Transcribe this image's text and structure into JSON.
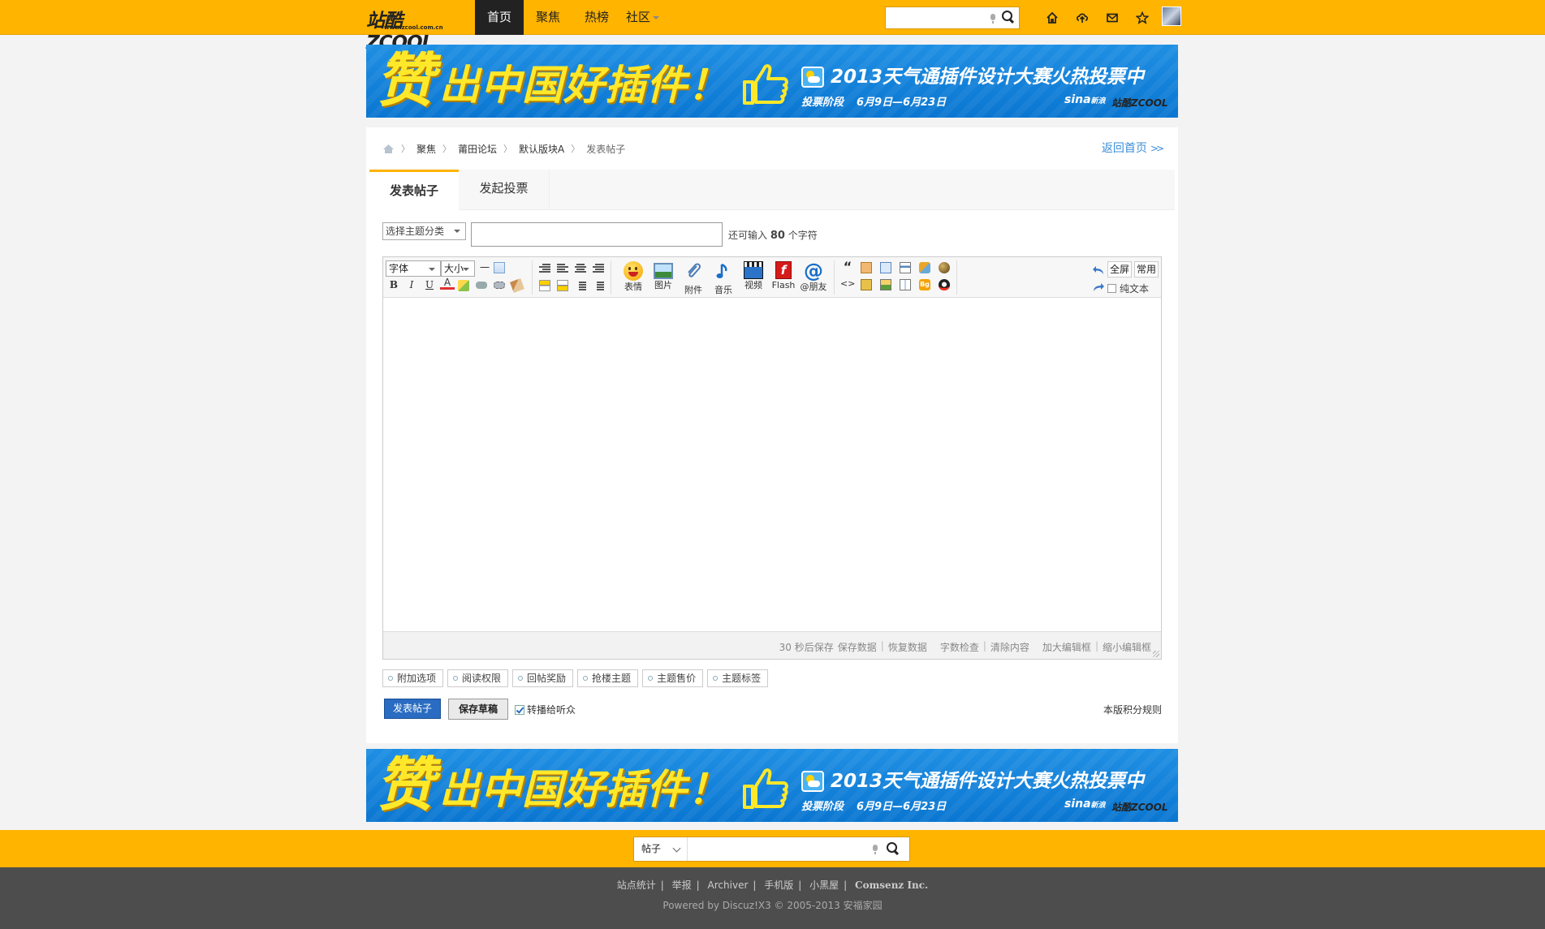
{
  "topbar": {
    "logo_text": "站酷ZCOOL",
    "logo_url_text": "www.zcool.com.cn",
    "nav": [
      {
        "label": "首页",
        "active": true
      },
      {
        "label": "聚焦",
        "active": false
      },
      {
        "label": "热榜",
        "active": false
      },
      {
        "label": "社区",
        "active": false
      }
    ],
    "search_placeholder": "",
    "icons": [
      "home-icon",
      "upload-icon",
      "mail-icon",
      "star-icon"
    ]
  },
  "banner": {
    "zan": "赞",
    "slogan": "出中国好插件！",
    "contest": "2013天气通插件设计大赛火热投票中",
    "phase": "投票阶段",
    "dates": "6月9日—6月23日",
    "sina": "sina",
    "sina_cn": "新浪",
    "zcool": "站酷ZCOOL"
  },
  "breadcrumb": {
    "items": [
      "聚焦",
      "莆田论坛",
      "默认版块A",
      "发表帖子"
    ],
    "back_home": "返回首页"
  },
  "tabs": [
    {
      "label": "发表帖子",
      "active": true
    },
    {
      "label": "发起投票",
      "active": false
    }
  ],
  "form": {
    "category_select": "选择主题分类",
    "title_value": "",
    "char_count_prefix": "还可输入",
    "char_count_value": "80",
    "char_count_suffix": "个字符"
  },
  "editor": {
    "font_select": "字体",
    "size_select": "大小",
    "fmt": {
      "bold": "B",
      "italic": "I",
      "underline": "U",
      "color": "A",
      "hr": "一"
    },
    "big_buttons": [
      {
        "label": "表情",
        "icon": "smiley-icon"
      },
      {
        "label": "图片",
        "icon": "image-icon"
      },
      {
        "label": "附件",
        "icon": "paperclip-icon"
      },
      {
        "label": "音乐",
        "icon": "music-icon"
      },
      {
        "label": "视频",
        "icon": "video-icon"
      },
      {
        "label": "Flash",
        "icon": "flash-icon"
      },
      {
        "label": "@朋友",
        "icon": "at-icon"
      }
    ],
    "quote": "“",
    "code": "<>",
    "fullscreen": "全屏",
    "common": "常用",
    "plain_text": "纯文本",
    "footer": {
      "autosave": "30 秒后保存",
      "save_data": "保存数据",
      "restore_data": "恢复数据",
      "word_check": "字数检查",
      "clear": "清除内容",
      "enlarge": "加大编辑框",
      "shrink": "缩小编辑框"
    },
    "colors": {
      "accent": "#ffb400",
      "button_blue": "#2a6cc2",
      "link_blue": "#3b8ed6"
    }
  },
  "options": [
    "附加选项",
    "阅读权限",
    "回帖奖励",
    "抢楼主题",
    "主题售价",
    "主题标签"
  ],
  "actions": {
    "submit": "发表帖子",
    "save_draft": "保存草稿",
    "sync": "转播给听众",
    "credit_rules": "本版积分规则"
  },
  "bottom_search": {
    "type": "帖子",
    "placeholder": ""
  },
  "footer": {
    "links": [
      "站点统计",
      "举报",
      "Archiver",
      "手机版",
      "小黑屋"
    ],
    "brand": "Comsenz Inc.",
    "copyright": "Powered by Discuz!X3 © 2005-2013 安福家园"
  }
}
